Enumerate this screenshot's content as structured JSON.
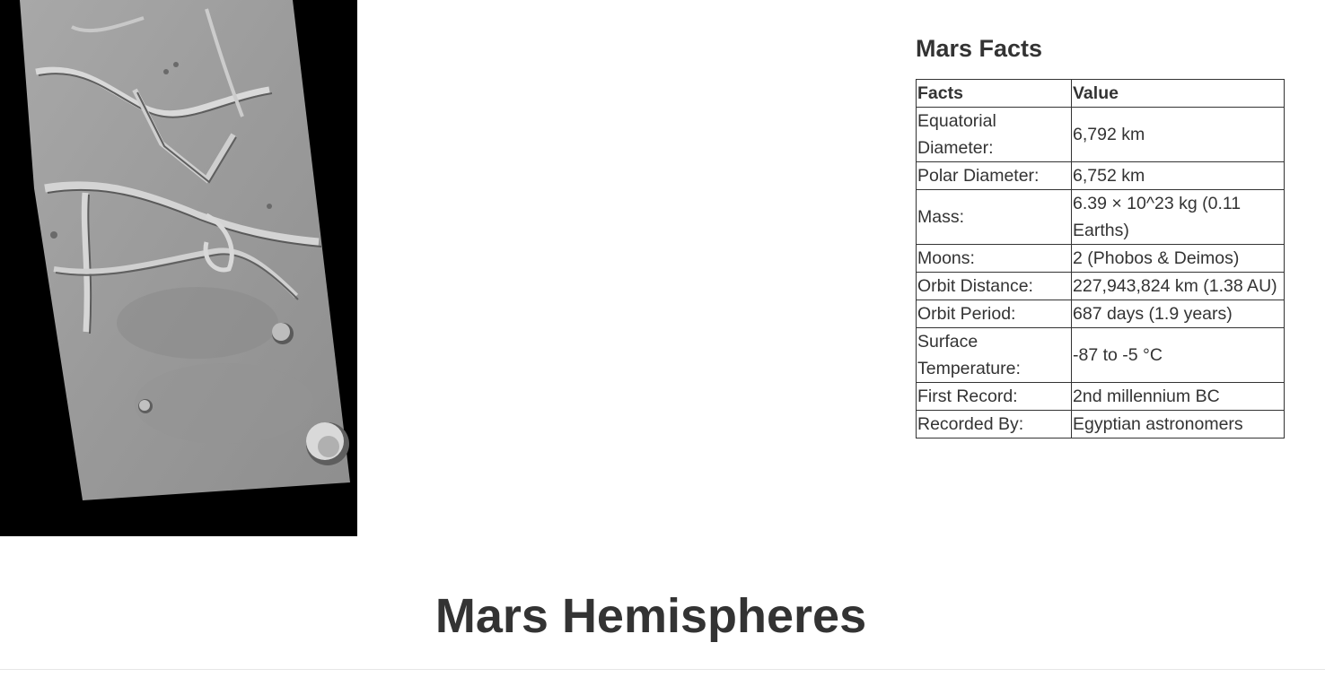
{
  "featured_image": {
    "alt": "Mars surface image",
    "background_color": "#000000"
  },
  "facts": {
    "title": "Mars Facts",
    "headers": [
      "Facts",
      "Value"
    ],
    "rows": [
      {
        "label": "Equatorial Diameter:",
        "value": "6,792 km"
      },
      {
        "label": "Polar Diameter:",
        "value": "6,752 km"
      },
      {
        "label": "Mass:",
        "value": "6.39 × 10^23 kg (0.11 Earths)"
      },
      {
        "label": "Moons:",
        "value": "2 (Phobos & Deimos)"
      },
      {
        "label": "Orbit Distance:",
        "value": "227,943,824 km (1.38 AU)"
      },
      {
        "label": "Orbit Period:",
        "value": "687 days (1.9 years)"
      },
      {
        "label": "Surface Temperature:",
        "value": "-87 to -5 °C"
      },
      {
        "label": "First Record:",
        "value": "2nd millennium BC"
      },
      {
        "label": "Recorded By:",
        "value": "Egyptian astronomers"
      }
    ]
  },
  "hemispheres": {
    "title": "Mars Hemispheres"
  }
}
